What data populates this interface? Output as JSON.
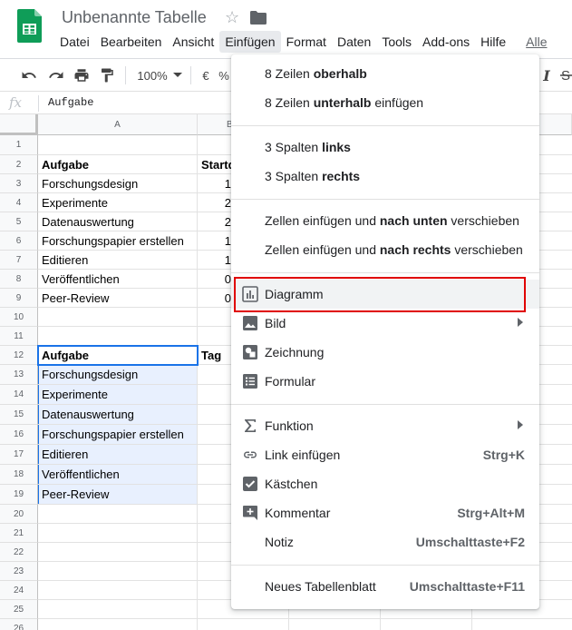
{
  "app": {
    "title": "Unbenannte Tabelle",
    "brand_color": "#0f9d58"
  },
  "menubar": {
    "items": [
      "Datei",
      "Bearbeiten",
      "Ansicht",
      "Einfügen",
      "Format",
      "Daten",
      "Tools",
      "Add-ons",
      "Hilfe"
    ],
    "active": "Einfügen",
    "last_link": "Alle"
  },
  "toolbar": {
    "zoom": "100%",
    "currency": "€",
    "percent": "%"
  },
  "formula_bar": {
    "fx": "fx",
    "content": "Aufgabe"
  },
  "grid": {
    "columns": [
      "A",
      "B"
    ],
    "rows": [
      "1",
      "2",
      "3",
      "4",
      "5",
      "6",
      "7",
      "8",
      "9",
      "10",
      "11",
      "12",
      "13",
      "14",
      "15",
      "16",
      "17",
      "18",
      "19",
      "20",
      "21",
      "22",
      "23",
      "24",
      "25",
      "26"
    ],
    "table1": {
      "header_a": "Aufgabe",
      "header_b": "Startd",
      "tasks": [
        "Forschungsdesign",
        "Experimente",
        "Datenauswertung",
        "Forschungspapier erstellen",
        "Editieren",
        "Veröffentlichen",
        "Peer-Review"
      ],
      "b_values": [
        "1",
        "2",
        "2",
        "1",
        "1",
        "0",
        "0"
      ]
    },
    "table2": {
      "header_a": "Aufgabe",
      "header_b": "Tag",
      "tasks": [
        "Forschungsdesign",
        "Experimente",
        "Datenauswertung",
        "Forschungspapier erstellen",
        "Editieren",
        "Veröffentlichen",
        "Peer-Review"
      ]
    }
  },
  "insert_menu": {
    "rows_above": {
      "pre": "8 Zeilen ",
      "bold": "oberhalb",
      "post": ""
    },
    "rows_below": {
      "pre": "8 Zeilen ",
      "bold": "unterhalb",
      "post": " einfügen"
    },
    "cols_left": {
      "pre": "3 Spalten ",
      "bold": "links",
      "post": ""
    },
    "cols_right": {
      "pre": "3 Spalten ",
      "bold": "rechts",
      "post": ""
    },
    "cells_down": {
      "pre": "Zellen einfügen und ",
      "bold": "nach unten",
      "post": " verschieben"
    },
    "cells_right": {
      "pre": "Zellen einfügen und ",
      "bold": "nach rechts",
      "post": " verschieben"
    },
    "chart": "Diagramm",
    "image": "Bild",
    "drawing": "Zeichnung",
    "form": "Formular",
    "function": "Funktion",
    "link": "Link einfügen",
    "link_shortcut": "Strg+K",
    "checkbox": "Kästchen",
    "comment": "Kommentar",
    "comment_shortcut": "Strg+Alt+M",
    "note": "Notiz",
    "note_shortcut": "Umschalttaste+F2",
    "new_sheet": "Neues Tabellenblatt",
    "new_sheet_shortcut": "Umschalttaste+F11",
    "highlight_color": "#e00000"
  }
}
